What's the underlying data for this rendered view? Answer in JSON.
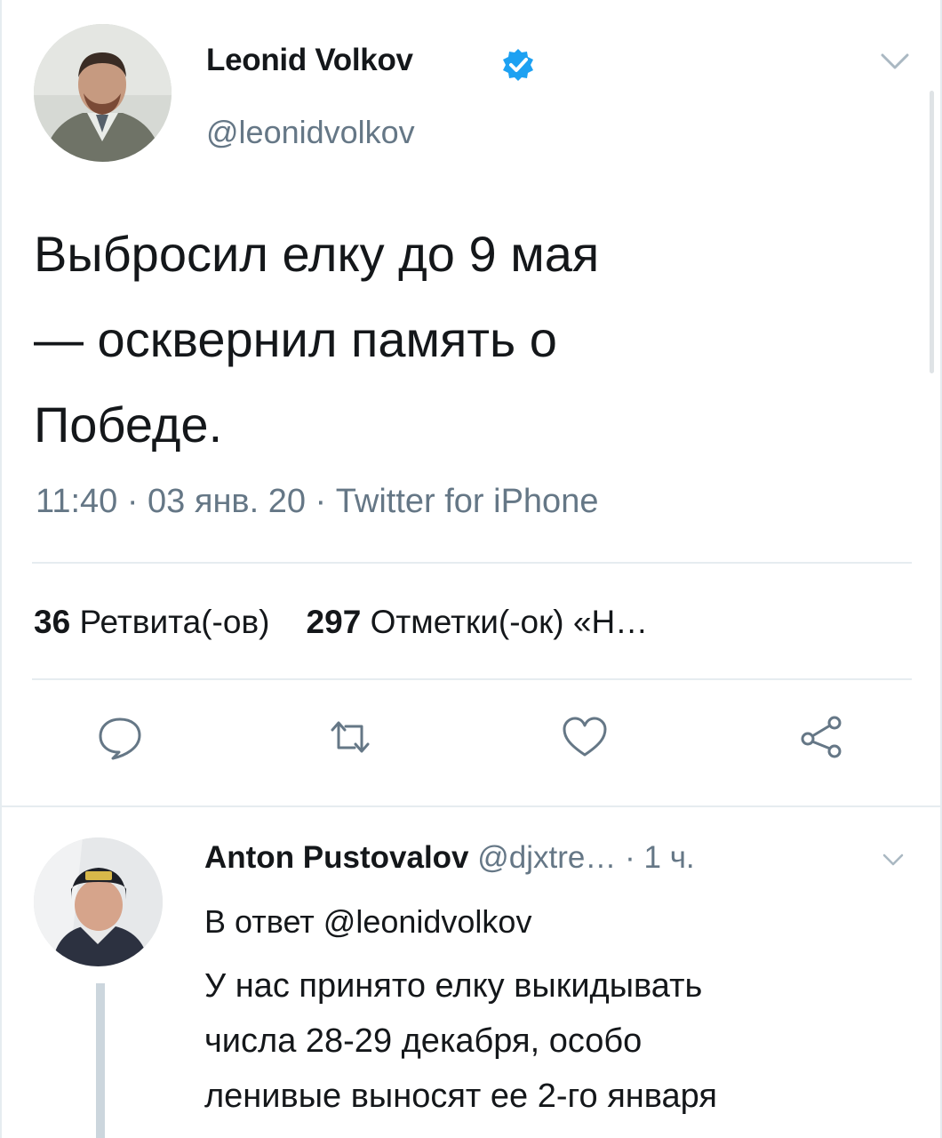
{
  "tweet": {
    "author_name": "Leonid Volkov",
    "author_handle": "@leonidvolkov",
    "verified": true,
    "text": "Выбросил елку до 9 мая\n— осквернил память о\nПобеде.",
    "meta": "11:40 · 03 янв. 20 · Twitter for iPhone",
    "stats": {
      "retweets_count": "36",
      "retweets_label": "Ретвита(-ов)",
      "likes_count": "297",
      "likes_label": "Отметки(-ок) «Н…"
    },
    "icons": {
      "avatar": "user-avatar",
      "verified": "verified-badge-icon",
      "menu": "chevron-down-icon",
      "reply": "comment-icon",
      "retweet": "retweet-icon",
      "like": "heart-icon",
      "share": "share-icon"
    }
  },
  "reply": {
    "author_name": "Anton Pustovalov",
    "author_handle": "@djxtre…",
    "time": "· 1 ч.",
    "reply_to": "В ответ @leonidvolkov",
    "text_lines": [
      "У нас принято елку выкидывать",
      "числа 28-29 декабря, особо",
      "ленивые выносят ее 2-го января"
    ]
  },
  "colors": {
    "text": "#14171a",
    "secondary": "#657786",
    "accent": "#1da1f2",
    "divider": "#e6ecf0"
  }
}
